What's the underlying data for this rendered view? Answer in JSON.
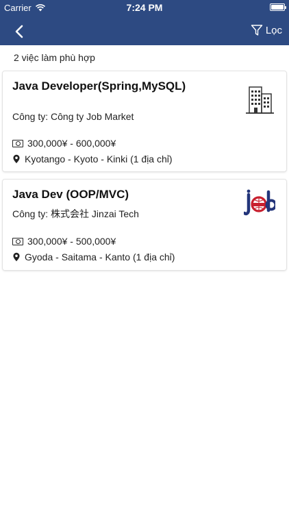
{
  "status_bar": {
    "carrier": "Carrier",
    "time": "7:24 PM"
  },
  "nav": {
    "filter_label": "Lọc"
  },
  "results": {
    "count_text": "2 việc làm phù hợp"
  },
  "jobs": [
    {
      "title": "Java Developer(Spring,MySQL)",
      "company": "Công ty: Công ty Job Market",
      "salary": "300,000¥ - 600,000¥",
      "location": "Kyotango - Kyoto - Kinki (1 địa chỉ)",
      "logo": "building-icon"
    },
    {
      "title": "Java Dev (OOP/MVC)",
      "company": "Công ty: 株式会社 Jinzai Tech",
      "salary": "300,000¥ - 500,000¥",
      "location": "Gyoda - Saitama - Kanto (1 địa chỉ)",
      "logo": "job-market-logo"
    }
  ],
  "colors": {
    "header_bg": "#2d4a82",
    "logo_red": "#c8202f",
    "logo_blue": "#23357a"
  }
}
